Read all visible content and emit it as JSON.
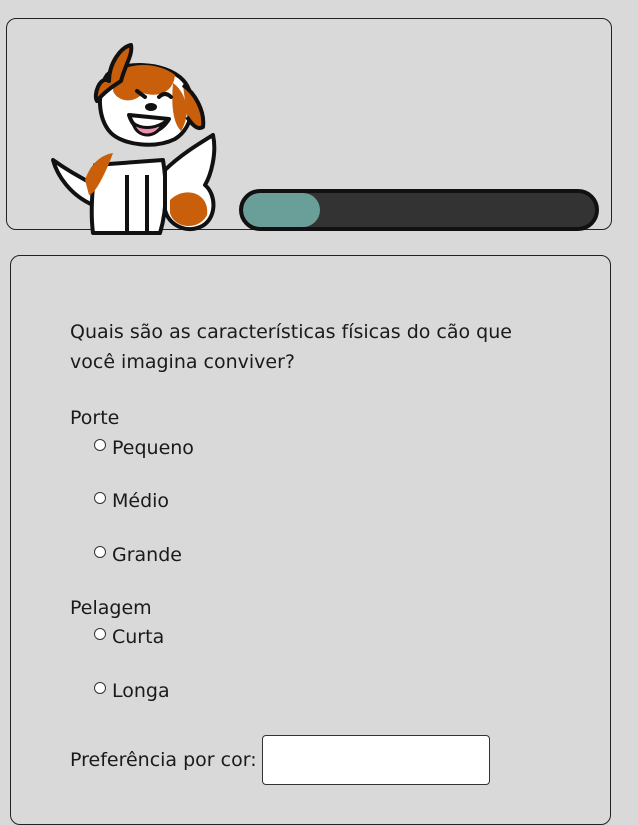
{
  "progress": {
    "fraction": 0.22
  },
  "colors": {
    "accent": "#6a9e98",
    "track": "#333333",
    "background": "#d9d9d9",
    "dog_patch": "#c95f0a",
    "dog_tongue": "#f08fb0"
  },
  "mascot": {
    "icon": "dog-icon"
  },
  "form": {
    "question": "Quais são as características físicas do cão que você imagina conviver?",
    "groups": [
      {
        "label": "Porte",
        "options": [
          "Pequeno",
          "Médio",
          "Grande"
        ]
      },
      {
        "label": "Pelagem",
        "options": [
          "Curta",
          "Longa"
        ]
      }
    ],
    "color": {
      "label": "Preferência por cor:",
      "value": ""
    }
  }
}
